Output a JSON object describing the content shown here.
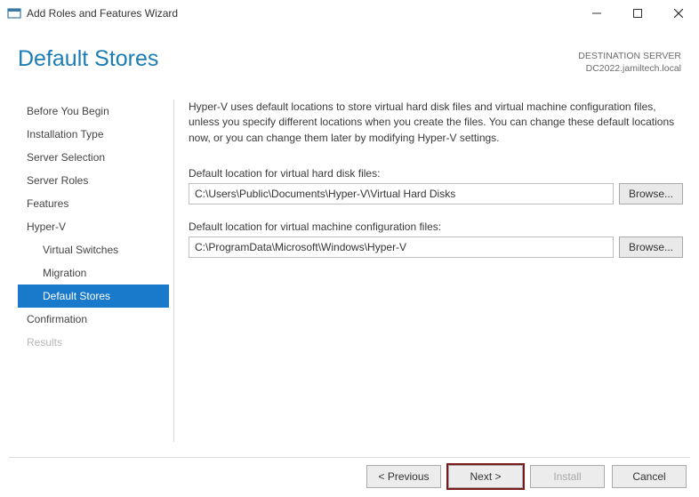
{
  "titlebar": {
    "title": "Add Roles and Features Wizard"
  },
  "header": {
    "page_title": "Default Stores",
    "destination_label": "DESTINATION SERVER",
    "destination_server": "DC2022.jamiltech.local"
  },
  "sidebar": {
    "items": [
      {
        "label": "Before You Begin"
      },
      {
        "label": "Installation Type"
      },
      {
        "label": "Server Selection"
      },
      {
        "label": "Server Roles"
      },
      {
        "label": "Features"
      },
      {
        "label": "Hyper-V"
      },
      {
        "label": "Virtual Switches",
        "sub": true
      },
      {
        "label": "Migration",
        "sub": true
      },
      {
        "label": "Default Stores",
        "sub": true,
        "selected": true
      },
      {
        "label": "Confirmation"
      },
      {
        "label": "Results",
        "disabled": true
      }
    ]
  },
  "main": {
    "intro": "Hyper-V uses default locations to store virtual hard disk files and virtual machine configuration files, unless you specify different locations when you create the files. You can change these default locations now, or you can change them later by modifying Hyper-V settings.",
    "vhd_label": "Default location for virtual hard disk files:",
    "vhd_path": "C:\\Users\\Public\\Documents\\Hyper-V\\Virtual Hard Disks",
    "vm_label": "Default location for virtual machine configuration files:",
    "vm_path": "C:\\ProgramData\\Microsoft\\Windows\\Hyper-V",
    "browse_label": "Browse..."
  },
  "footer": {
    "previous": "< Previous",
    "next": "Next >",
    "install": "Install",
    "cancel": "Cancel"
  }
}
